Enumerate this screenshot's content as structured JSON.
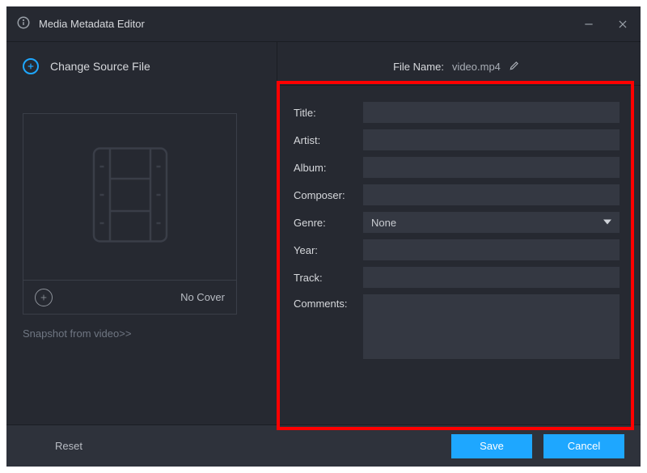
{
  "window": {
    "title": "Media Metadata Editor"
  },
  "actions": {
    "change_source": "Change Source File",
    "no_cover": "No Cover",
    "snapshot_link": "Snapshot from video>>",
    "reset": "Reset",
    "save": "Save",
    "cancel": "Cancel"
  },
  "file": {
    "label": "File Name:",
    "name": "video.mp4"
  },
  "form": {
    "labels": {
      "title": "Title:",
      "artist": "Artist:",
      "album": "Album:",
      "composer": "Composer:",
      "genre": "Genre:",
      "year": "Year:",
      "track": "Track:",
      "comments": "Comments:"
    },
    "values": {
      "title": "",
      "artist": "",
      "album": "",
      "composer": "",
      "genre": "None",
      "year": "",
      "track": "",
      "comments": ""
    }
  },
  "colors": {
    "accent": "#1ea7ff",
    "highlight": "#ff0000"
  }
}
